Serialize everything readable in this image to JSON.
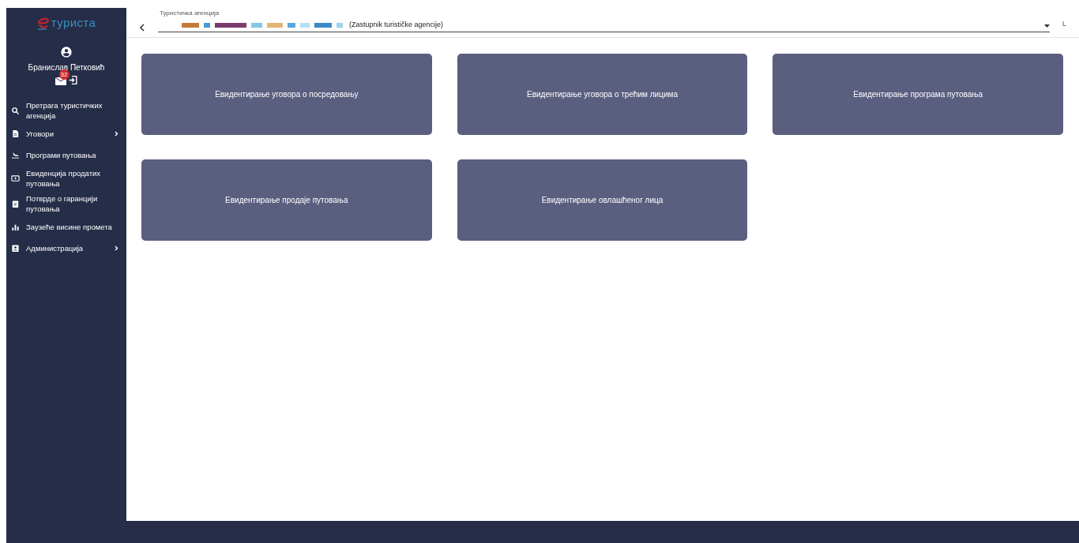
{
  "logo": {
    "text": "туриста"
  },
  "user": {
    "name": "Бранислав Петковић",
    "unread_count": "32"
  },
  "sidebar": {
    "items": [
      {
        "label": "Претрага туристичких агенција",
        "kind": "search",
        "has_submenu": false
      },
      {
        "label": "Уговори",
        "kind": "document",
        "has_submenu": true
      },
      {
        "label": "Програми путовања",
        "kind": "plane",
        "has_submenu": false
      },
      {
        "label": "Евиденција продатих путовања",
        "kind": "monitor",
        "has_submenu": false
      },
      {
        "label": "Потврде о гаранцији путовања",
        "kind": "clipboard",
        "has_submenu": false
      },
      {
        "label": "Заузеће висине промета",
        "kind": "chart",
        "has_submenu": false
      },
      {
        "label": "Администрација",
        "kind": "badge",
        "has_submenu": true
      }
    ]
  },
  "agency_select": {
    "label": "Туристичка агенција",
    "value": "(Zastupnik turističke agencije)"
  },
  "header_right": "L",
  "tiles": [
    {
      "label": "Евидентирање уговора о посредовању"
    },
    {
      "label": "Евидентирање уговора о трећим лицима"
    },
    {
      "label": "Евидентирање програма путовања"
    },
    {
      "label": "Евидентирање продаје путовања"
    },
    {
      "label": "Евидентирање овлашћеног лица"
    }
  ]
}
